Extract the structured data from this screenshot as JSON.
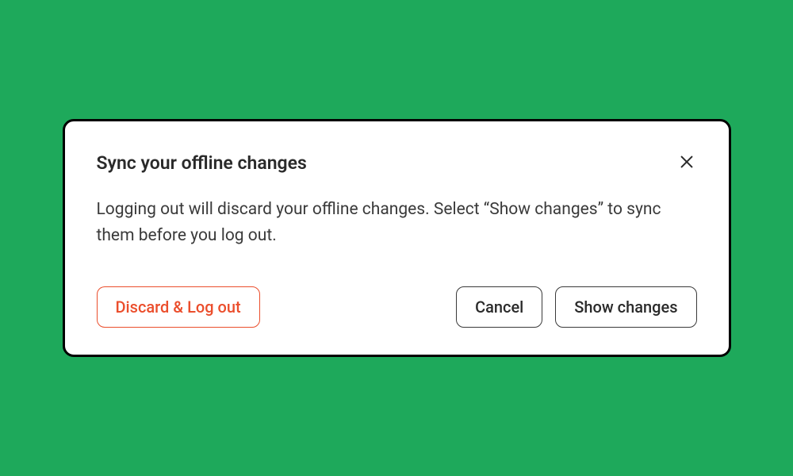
{
  "dialog": {
    "title": "Sync your offline changes",
    "body": "Logging out will discard your offline changes. Select “Show changes” to sync them before you log out.",
    "buttons": {
      "discard": "Discard & Log out",
      "cancel": "Cancel",
      "show": "Show changes"
    }
  },
  "colors": {
    "background": "#1EA95B",
    "destructive": "#EB4E2C",
    "text": "#2a2a2a"
  }
}
